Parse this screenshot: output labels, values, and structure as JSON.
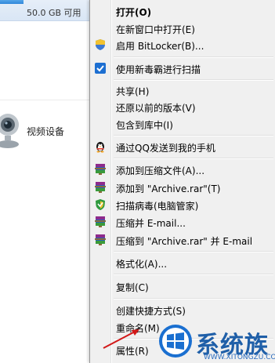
{
  "background": {
    "drive_size": "50.0 GB 可用",
    "device_label": "视频设备"
  },
  "menu": {
    "items": [
      {
        "label": "打开(O)",
        "icon": null,
        "bold": true
      },
      {
        "label": "在新窗口中打开(E)",
        "icon": null
      },
      {
        "label": "启用 BitLocker(B)...",
        "icon": "shield-icon"
      },
      {
        "label": "使用新毒霸进行扫描",
        "icon": "antivirus-icon"
      },
      {
        "label": "共享(H)",
        "icon": null
      },
      {
        "label": "还原以前的版本(V)",
        "icon": null
      },
      {
        "label": "包含到库中(I)",
        "icon": null
      },
      {
        "label": "通过QQ发送到我的手机",
        "icon": "qq-penguin-icon"
      },
      {
        "label": "添加到压缩文件(A)...",
        "icon": "winrar-icon"
      },
      {
        "label": "添加到 \"Archive.rar\"(T)",
        "icon": "winrar-icon"
      },
      {
        "label": "扫描病毒(电脑管家)",
        "icon": "pc-manager-shield-icon"
      },
      {
        "label": "压缩并 E-mail...",
        "icon": "winrar-icon"
      },
      {
        "label": "压缩到 \"Archive.rar\" 并 E-mail",
        "icon": "winrar-icon"
      },
      {
        "label": "格式化(A)...",
        "icon": null
      },
      {
        "label": "复制(C)",
        "icon": null
      },
      {
        "label": "创建快捷方式(S)",
        "icon": null
      },
      {
        "label": "重命名(M)",
        "icon": null
      },
      {
        "label": "属性(R)",
        "icon": null
      }
    ]
  },
  "watermark": {
    "brand": "系统族",
    "url": "WWW.XITONGZU.COM"
  },
  "colors": {
    "menu_bg": "#f0f0f0",
    "watermark_blue": "#1f5fa8",
    "arrow_red": "#d21919"
  }
}
